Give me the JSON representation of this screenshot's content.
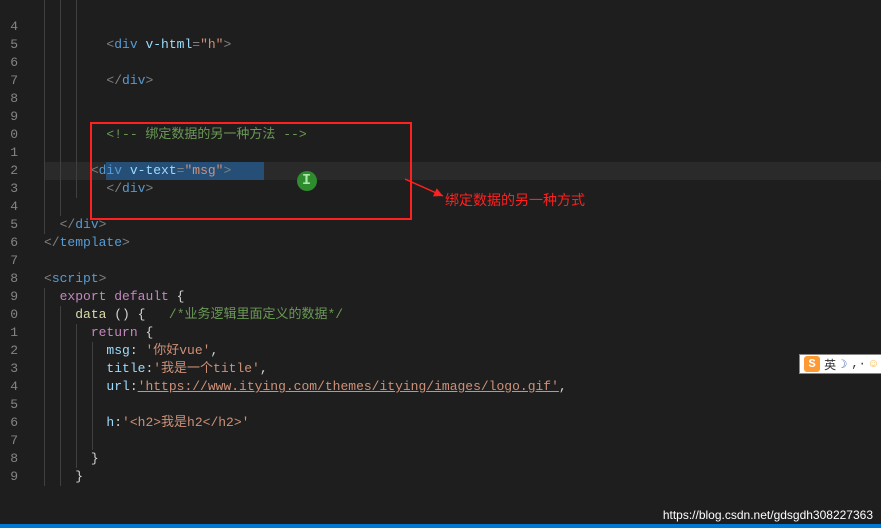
{
  "gutter_lines": [
    "",
    "4",
    "5",
    "6",
    "7",
    "8",
    "9",
    "0",
    "1",
    "2",
    "3",
    "4",
    "5",
    "6",
    "7",
    "8",
    "9",
    "0",
    "1",
    "2",
    "3",
    "4",
    "5",
    "6",
    "7",
    "8",
    "9"
  ],
  "code": {
    "l5_pre": "        ",
    "l5_open": "<",
    "l5_tag": "div",
    "l5_sp": " ",
    "l5_attr": "v-html",
    "l5_eq": "=",
    "l5_str": "\"h\"",
    "l5_close": ">",
    "l7_pre": "        ",
    "l7_open": "</",
    "l7_tag": "div",
    "l7_close": ">",
    "l10_pre": "        ",
    "l10_comment": "<!-- 绑定数据的另一种方法 -->",
    "l12_pre": "      ",
    "l12_open": "<",
    "l12_tag": "div",
    "l12_sp": " ",
    "l12_attr": "v-text",
    "l12_eq": "=",
    "l12_str": "\"msg\"",
    "l12_close": ">",
    "l13_pre": "        ",
    "l13_open": "</",
    "l13_tag": "div",
    "l13_close": ">",
    "l15_pre": "  ",
    "l15_open": "</",
    "l15_tag": "div",
    "l15_close": ">",
    "l16_open": "</",
    "l16_tag": "template",
    "l16_close": ">",
    "l18_open": "<",
    "l18_tag": "script",
    "l18_close": ">",
    "l19_pre": "  ",
    "l19_export": "export",
    "l19_sp": " ",
    "l19_default": "default",
    "l19_sp2": " ",
    "l19_brace": "{",
    "l20_pre": "    ",
    "l20_fn": "data",
    "l20_sp": " ",
    "l20_paren": "()",
    "l20_sp2": " ",
    "l20_brace": "{",
    "l20_sp3": "   ",
    "l20_comment": "/*业务逻辑里面定义的数据*/",
    "l21_pre": "      ",
    "l21_return": "return",
    "l21_sp": " ",
    "l21_brace": "{",
    "l22_pre": "        ",
    "l22_key": "msg",
    "l22_colon": ": ",
    "l22_val": "'你好vue'",
    "l22_comma": ",",
    "l23_pre": "        ",
    "l23_key": "title",
    "l23_colon": ":",
    "l23_val": "'我是一个title'",
    "l23_comma": ",",
    "l24_pre": "        ",
    "l24_key": "url",
    "l24_colon": ":",
    "l24_val": "'https://www.itying.com/themes/itying/images/logo.gif'",
    "l24_comma": ",",
    "l26_pre": "        ",
    "l26_key": "h",
    "l26_colon": ":",
    "l26_val": "'<h2>我是h2</h2>'",
    "l28_pre": "      ",
    "l28_brace": "}",
    "l29_pre": "    ",
    "l29_brace": "}"
  },
  "annotation": {
    "label": "绑定数据的另一种方式"
  },
  "ime": {
    "s": "S",
    "txt": "英",
    "moon": "☽",
    "comma": ",·",
    "smile": "☺"
  },
  "watermark": "https://blog.csdn.net/gdsgdh308227363"
}
